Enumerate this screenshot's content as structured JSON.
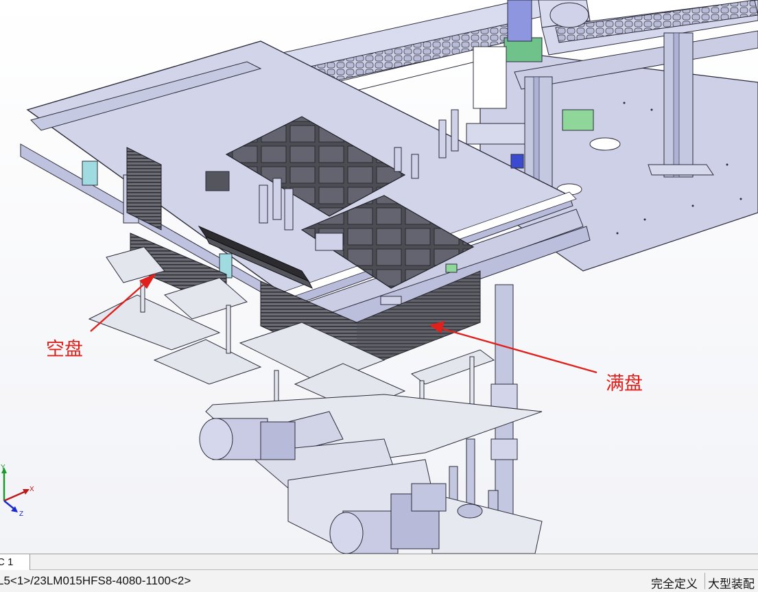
{
  "viewport": {
    "annotations": {
      "empty_tray": "空盘",
      "full_tray": "满盘"
    },
    "triad": {
      "x": "X",
      "y": "Y",
      "z": "Z"
    },
    "colors": {
      "annotation": "#e0211b",
      "part_body": "#c9cbe4",
      "part_stroke": "#2b2b3a",
      "tray_dark": "#555560",
      "plate_light": "#e4e6ee"
    }
  },
  "tabs": [
    {
      "label": "C 1"
    }
  ],
  "status": {
    "path": "L5<1>/23LM015HFS8-4080-1100<2>",
    "definition": "完全定义",
    "mode": "大型装配"
  }
}
